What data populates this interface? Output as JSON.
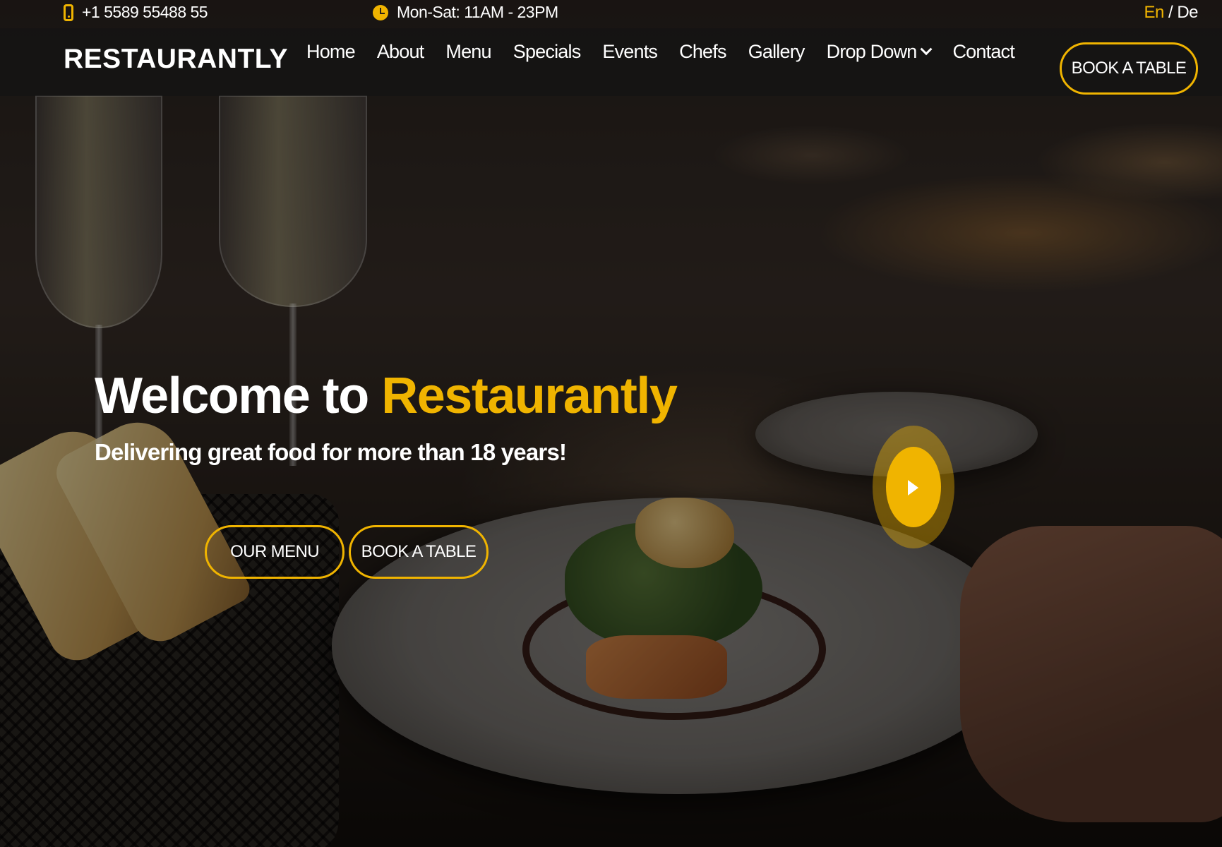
{
  "topbar": {
    "phone": "+1 5589 55488 55",
    "hours": "Mon-Sat: 11AM - 23PM",
    "lang_en": "En",
    "lang_sep": "/",
    "lang_de": "De"
  },
  "header": {
    "logo": "RESTAURANTLY",
    "nav": [
      {
        "label": "Home"
      },
      {
        "label": "About"
      },
      {
        "label": "Menu"
      },
      {
        "label": "Specials"
      },
      {
        "label": "Events"
      },
      {
        "label": "Chefs"
      },
      {
        "label": "Gallery"
      },
      {
        "label": "Drop Down"
      },
      {
        "label": "Contact"
      }
    ],
    "book_button": "BOOK A TABLE"
  },
  "hero": {
    "title_prefix": "Welcome to",
    "title_accent": "Restaurantly",
    "subtitle": "Delivering great food for more than 18 years!",
    "menu_button": "OUR MENU",
    "book_button": "BOOK A TABLE"
  },
  "colors": {
    "accent": "#f0b400",
    "text": "#ffffff",
    "header_bg": "#141414"
  },
  "icons": {
    "phone": "mobile-phone-icon",
    "hours": "clock-icon",
    "dropdown": "chevron-down-icon",
    "video": "play-icon"
  }
}
